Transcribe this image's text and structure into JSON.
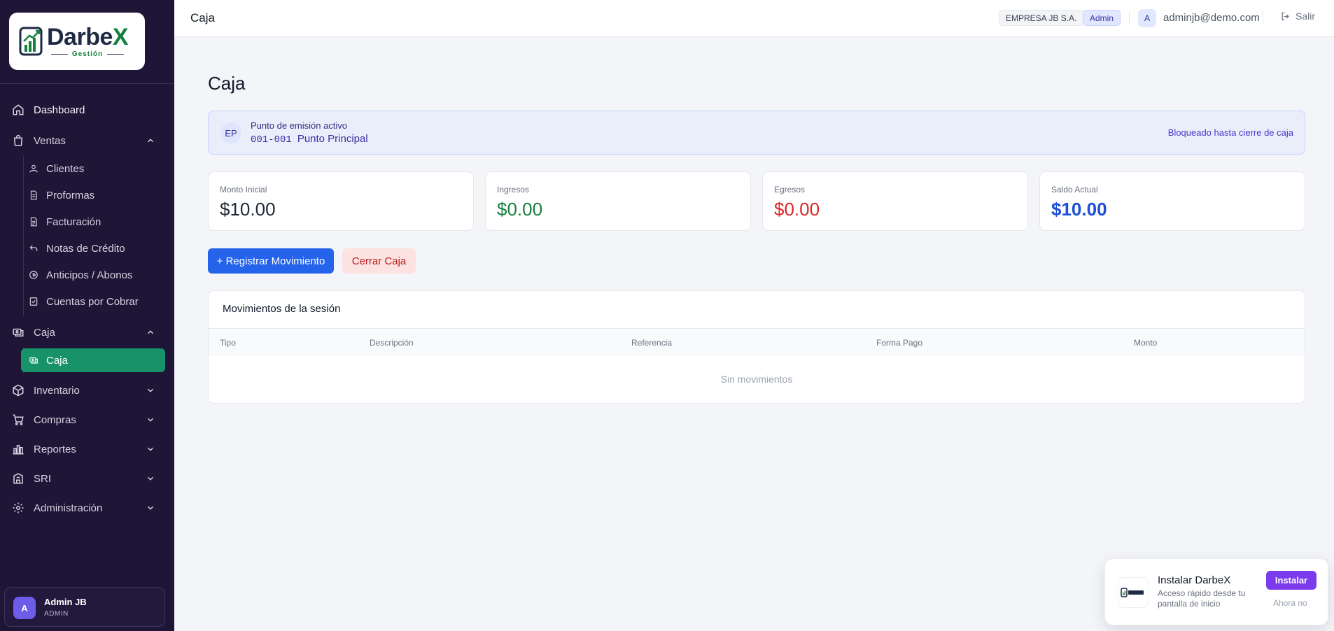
{
  "brand": {
    "name_main": "Darbe",
    "name_x": "X",
    "tagline": "Gestión"
  },
  "sidebar": {
    "items": [
      {
        "label": "Dashboard",
        "icon": "home-icon"
      },
      {
        "label": "Ventas",
        "icon": "shopping-bag-icon",
        "expanded": true,
        "children": [
          {
            "label": "Clientes",
            "icon": "users-icon"
          },
          {
            "label": "Proformas",
            "icon": "document-icon"
          },
          {
            "label": "Facturación",
            "icon": "invoice-icon"
          },
          {
            "label": "Notas de Crédito",
            "icon": "undo-icon"
          },
          {
            "label": "Anticipos / Abonos",
            "icon": "coin-icon"
          },
          {
            "label": "Cuentas por Cobrar",
            "icon": "receivable-icon"
          }
        ]
      },
      {
        "label": "Caja",
        "icon": "cash-register-icon",
        "expanded": true,
        "children": [
          {
            "label": "Caja",
            "icon": "cash-icon",
            "active": true
          }
        ]
      },
      {
        "label": "Inventario",
        "icon": "box-icon"
      },
      {
        "label": "Compras",
        "icon": "cart-icon"
      },
      {
        "label": "Reportes",
        "icon": "bar-chart-icon"
      },
      {
        "label": "SRI",
        "icon": "building-icon"
      },
      {
        "label": "Administración",
        "icon": "gear-icon"
      }
    ]
  },
  "user": {
    "initial": "A",
    "name": "Admin JB",
    "role": "ADMIN"
  },
  "topbar": {
    "title": "Caja",
    "company": "EMPRESA JB S.A.",
    "role": "Admin",
    "avatar_initial": "A",
    "email": "adminjb@demo.com",
    "logout": "Salir"
  },
  "page": {
    "title": "Caja",
    "emission": {
      "badge": "EP",
      "label": "Punto de emisión activo",
      "code": "001-001",
      "name": "Punto Principal",
      "lock_note": "Bloqueado hasta cierre de caja"
    },
    "stats": [
      {
        "label": "Monto Inicial",
        "value": "$10.00",
        "color": "#1f2937"
      },
      {
        "label": "Ingresos",
        "value": "$0.00",
        "color": "#15803d"
      },
      {
        "label": "Egresos",
        "value": "$0.00",
        "color": "#dc2626"
      },
      {
        "label": "Saldo Actual",
        "value": "$10.00",
        "color": "#1d4ed8"
      }
    ],
    "actions": {
      "register": "+ Registrar Movimiento",
      "close": "Cerrar Caja"
    },
    "movements": {
      "title": "Movimientos de la sesión",
      "columns": [
        "Tipo",
        "Descripción",
        "Referencia",
        "Forma Pago",
        "Monto"
      ],
      "empty": "Sin movimientos"
    }
  },
  "install_prompt": {
    "title": "Instalar DarbeX",
    "description": "Acceso rápido desde tu pantalla de inicio",
    "install": "Instalar",
    "later": "Ahora no"
  },
  "colors": {
    "sidebar_bg": "#1e1537",
    "active_green": "#179269",
    "primary": "#2563eb",
    "install_purple": "#7c3aed"
  }
}
